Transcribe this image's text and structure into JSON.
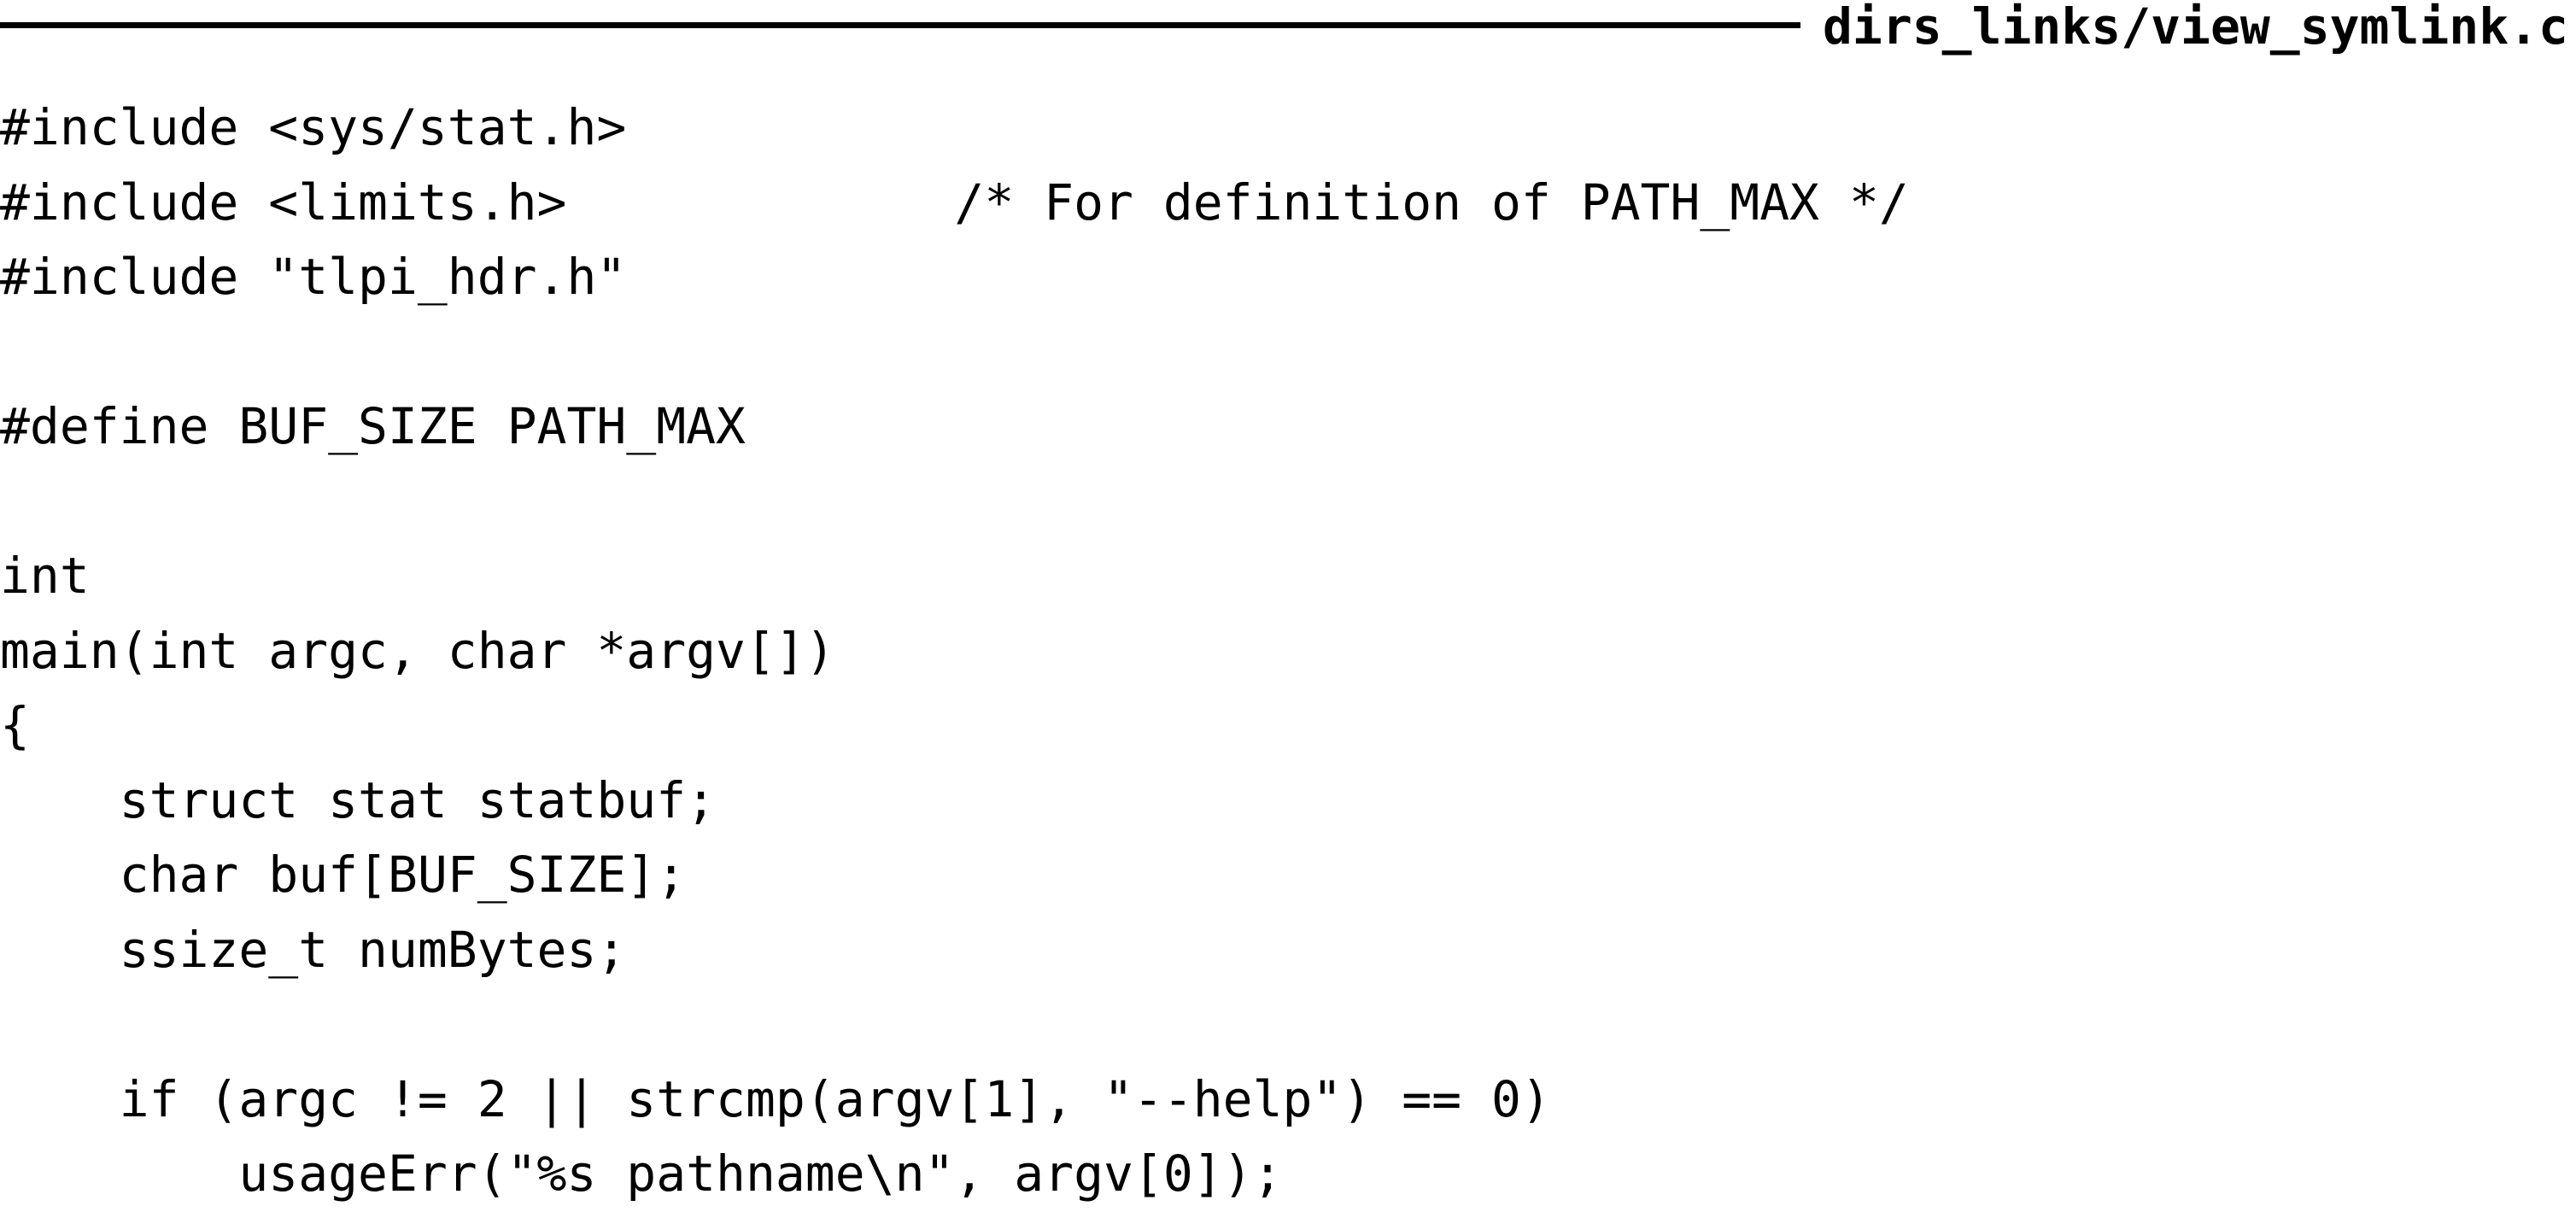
{
  "listing": {
    "filename": "dirs_links/view_symlink.c",
    "lines": [
      "#include <sys/stat.h>",
      "#include <limits.h>             /* For definition of PATH_MAX */",
      "#include \"tlpi_hdr.h\"",
      "",
      "#define BUF_SIZE PATH_MAX",
      "",
      "int",
      "main(int argc, char *argv[])",
      "{",
      "    struct stat statbuf;",
      "    char buf[BUF_SIZE];",
      "    ssize_t numBytes;",
      "",
      "    if (argc != 2 || strcmp(argv[1], \"--help\") == 0)",
      "        usageErr(\"%s pathname\\n\", argv[0]);"
    ]
  }
}
